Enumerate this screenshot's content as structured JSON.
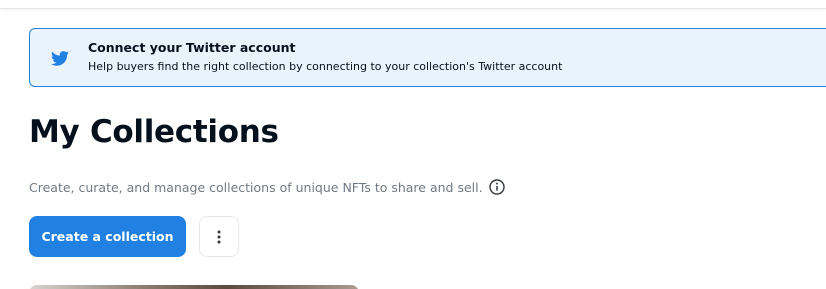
{
  "banner": {
    "title": "Connect your Twitter account",
    "text": "Help buyers find the right collection by connecting to your collection's Twitter account",
    "icon": "twitter-icon"
  },
  "main": {
    "title": "My Collections",
    "subtitle": "Create, curate, and manage collections of unique NFTs to share and sell.",
    "info_icon": "info-icon",
    "create_button_label": "Create a collection",
    "more_icon": "vertical-dots-icon"
  },
  "colors": {
    "accent": "#2081e2",
    "banner_bg": "#e9f3fc",
    "text_primary": "#04111d",
    "text_secondary": "#707a83"
  }
}
